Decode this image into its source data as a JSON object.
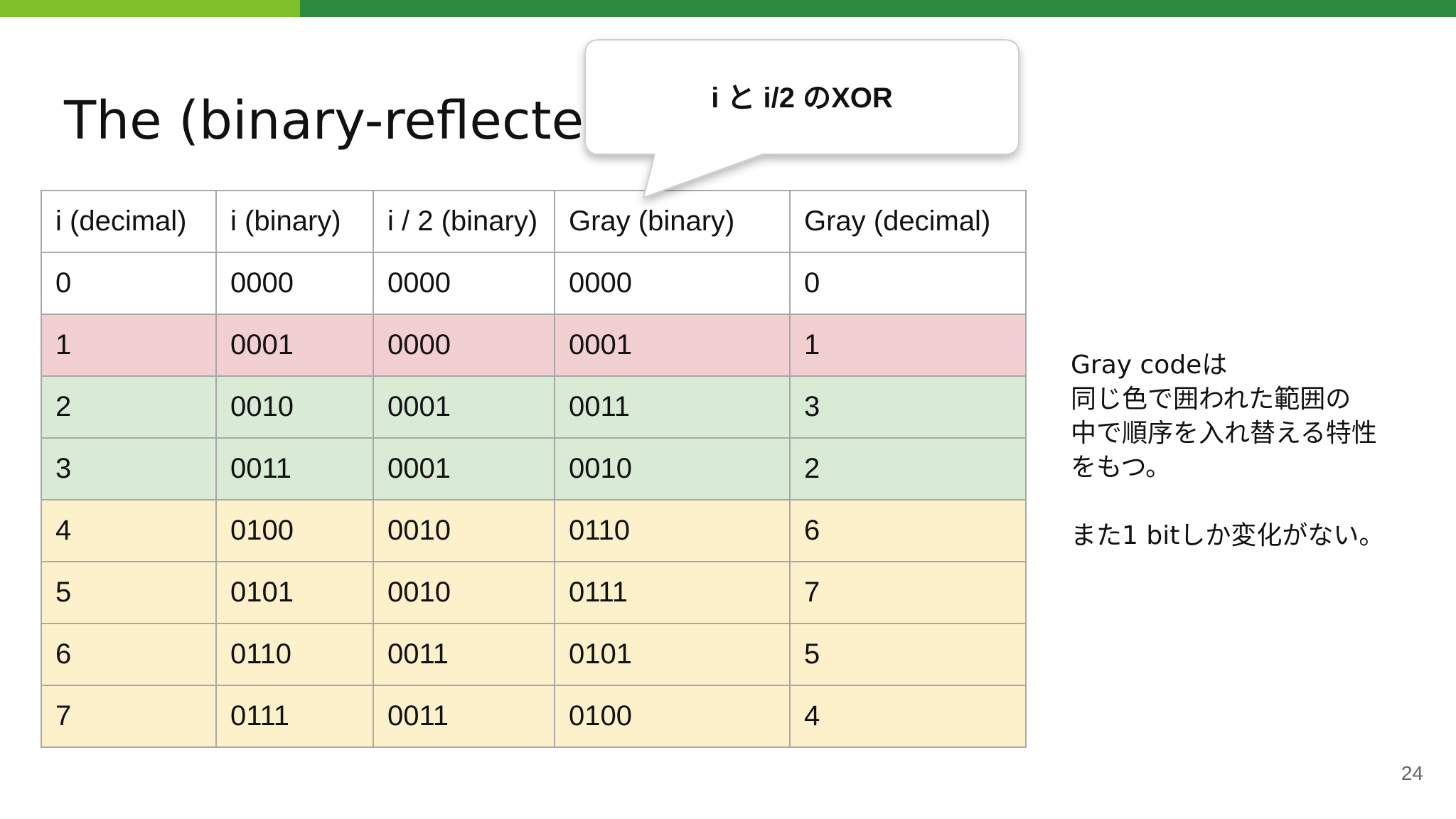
{
  "slide": {
    "title": "The (binary-reflected",
    "callout": "i と i/2 のXOR",
    "page_number": "24",
    "colors": {
      "bar_dark": "#2e8b3e",
      "bar_light": "#7fbf2a",
      "row_red": "#f2cfd0",
      "row_green": "#d9ead5",
      "row_yellow": "#fdf1cc"
    }
  },
  "table": {
    "headers": [
      "i (decimal)",
      "i (binary)",
      "i / 2 (binary)",
      "Gray (binary)",
      "Gray (decimal)"
    ],
    "rows": [
      {
        "cells": [
          "0",
          "0000",
          "0000",
          "0000",
          "0"
        ],
        "color": "white"
      },
      {
        "cells": [
          "1",
          "0001",
          "0000",
          "0001",
          "1"
        ],
        "color": "red"
      },
      {
        "cells": [
          "2",
          "0010",
          "0001",
          "0011",
          "3"
        ],
        "color": "green"
      },
      {
        "cells": [
          "3",
          "0011",
          "0001",
          "0010",
          "2"
        ],
        "color": "green"
      },
      {
        "cells": [
          "4",
          "0100",
          "0010",
          "0110",
          "6"
        ],
        "color": "yellow"
      },
      {
        "cells": [
          "5",
          "0101",
          "0010",
          "0111",
          "7"
        ],
        "color": "yellow"
      },
      {
        "cells": [
          "6",
          "0110",
          "0011",
          "0101",
          "5"
        ],
        "color": "yellow"
      },
      {
        "cells": [
          "7",
          "0111",
          "0011",
          "0100",
          "4"
        ],
        "color": "yellow"
      }
    ]
  },
  "note": {
    "lines": [
      "Gray codeは",
      "同じ色で囲われた範囲の",
      "中で順序を入れ替える特性",
      "をもつ。"
    ],
    "extra": "また1 bitしか変化がない。"
  }
}
